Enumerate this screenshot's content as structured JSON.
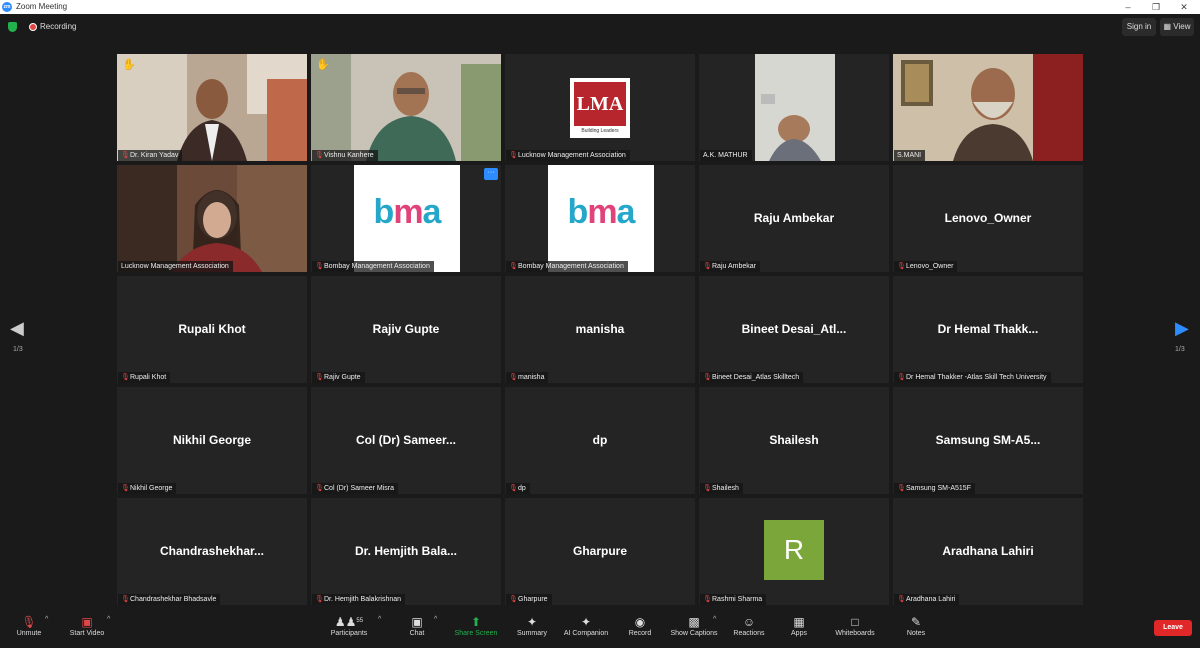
{
  "window": {
    "title": "Zoom Meeting",
    "logo": "zm"
  },
  "topbar": {
    "recording_label": "Recording",
    "sign_in": "Sign in",
    "view": "View"
  },
  "tiles": [
    {
      "name": "Dr. Kiran Yadav",
      "hand": true,
      "type": "video"
    },
    {
      "name": "Vishnu Kanhere",
      "hand": true,
      "type": "video"
    },
    {
      "name": "Lucknow Management Association",
      "type": "lma-logo",
      "logo_text": "LMA",
      "logo_sub": "Building Leaders"
    },
    {
      "name": "A.K. MATHUR",
      "type": "video"
    },
    {
      "name": "S.MANI",
      "type": "video",
      "active": true
    },
    {
      "name": "Lucknow Management Association",
      "type": "video",
      "muted": false
    },
    {
      "name": "Bombay Management Association",
      "type": "bma-logo",
      "logo_text": "bma",
      "more": "···"
    },
    {
      "name": "Bombay Management Association",
      "type": "bma-logo",
      "logo_text": "bma"
    },
    {
      "name": "Raju Ambekar",
      "display": "Raju Ambekar",
      "type": "name"
    },
    {
      "name": "Lenovo_Owner",
      "display": "Lenovo_Owner",
      "type": "name"
    },
    {
      "name": "Rupali Khot",
      "display": "Rupali Khot",
      "type": "name"
    },
    {
      "name": "Rajiv Gupte",
      "display": "Rajiv Gupte",
      "type": "name"
    },
    {
      "name": "manisha",
      "display": "manisha",
      "type": "name"
    },
    {
      "name": "Bineet Desai_Atlas Skilltech",
      "display": "Bineet Desai_Atl...",
      "type": "name"
    },
    {
      "name": "Dr Hemal Thakker -Atlas Skill Tech University",
      "display": "Dr Hemal Thakk...",
      "type": "name"
    },
    {
      "name": "Nikhil George",
      "display": "Nikhil George",
      "type": "name"
    },
    {
      "name": "Col (Dr) Sameer Misra",
      "display": "Col (Dr) Sameer...",
      "type": "name"
    },
    {
      "name": "dp",
      "display": "dp",
      "type": "name"
    },
    {
      "name": "Shailesh",
      "display": "Shailesh",
      "type": "name"
    },
    {
      "name": "Samsung SM-A515F",
      "display": "Samsung SM-A5...",
      "type": "name"
    },
    {
      "name": "Chandrashekhar Bhadsavle",
      "display": "Chandrashekhar...",
      "type": "name"
    },
    {
      "name": "Dr. Hemjith Balakrishnan",
      "display": "Dr. Hemjith Bala...",
      "type": "name"
    },
    {
      "name": "Gharpure",
      "display": "Gharpure",
      "type": "name"
    },
    {
      "name": "Rashmi Sharma",
      "type": "avatar",
      "initial": "R"
    },
    {
      "name": "Aradhana Lahiri",
      "display": "Aradhana Lahiri",
      "type": "name"
    }
  ],
  "pagination": {
    "left": "1/3",
    "right": "1/3"
  },
  "toolbar": {
    "unmute": "Unmute",
    "start_video": "Start Video",
    "participants": "Participants",
    "participants_count": "55",
    "chat": "Chat",
    "share_screen": "Share Screen",
    "summary": "Summary",
    "ai_companion": "AI Companion",
    "record": "Record",
    "show_captions": "Show Captions",
    "reactions": "Reactions",
    "apps": "Apps",
    "whiteboards": "Whiteboards",
    "notes": "Notes",
    "leave": "Leave"
  },
  "colors": {
    "accent": "#2d8cff",
    "share": "#22b14c",
    "leave": "#e02828",
    "active_speaker": "#d6e33c"
  }
}
